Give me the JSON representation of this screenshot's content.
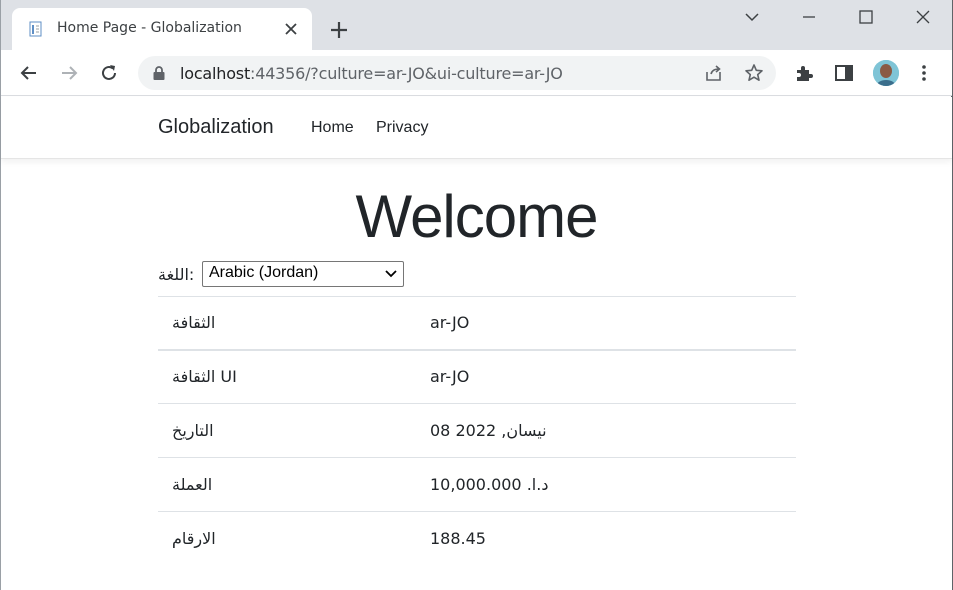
{
  "browser": {
    "tab": {
      "title": "Home Page - Globalization"
    },
    "address": {
      "host": "localhost",
      "rest": ":44356/?culture=ar-JO&ui-culture=ar-JO"
    }
  },
  "site": {
    "brand": "Globalization",
    "nav": [
      {
        "label": "Home"
      },
      {
        "label": "Privacy"
      }
    ]
  },
  "main": {
    "heading": "Welcome",
    "language_label": "اللغة:",
    "language_selected": "Arabic (Jordan)",
    "rows": [
      {
        "key": "الثقافة",
        "value": "ar-JO"
      },
      {
        "key": "الثقافة UI",
        "value": "ar-JO"
      },
      {
        "key": "التاريخ",
        "value": "08 نيسان, 2022"
      },
      {
        "key": "العملة",
        "value": "د.ا. 10,000.000"
      },
      {
        "key": "الارقام",
        "value": "188.45"
      }
    ]
  },
  "icons": [
    "page-favicon-icon",
    "close-icon",
    "plus-icon",
    "chevron-down-icon",
    "minimize-icon",
    "maximize-icon",
    "close-window-icon",
    "back-arrow-icon",
    "forward-arrow-icon",
    "reload-icon",
    "lock-icon",
    "share-icon",
    "star-icon",
    "puzzle-icon",
    "side-panel-icon",
    "avatar",
    "kebab-menu-icon"
  ]
}
